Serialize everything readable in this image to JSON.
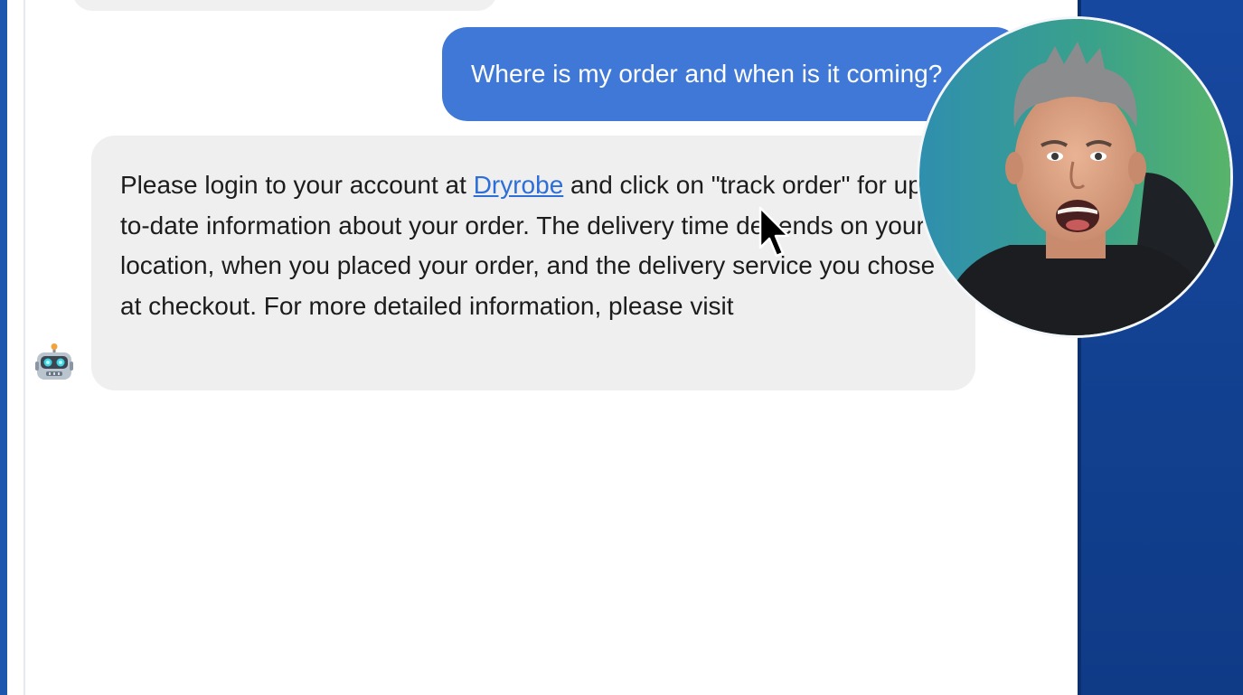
{
  "chat": {
    "user_message": "Where is my order and when is it coming?",
    "bot_message": {
      "before_link": "Please login to your account at ",
      "link_text": "Dryrobe",
      "after_link": " and click on \"track order\" for up-to-date information about your order. The delivery time depends on your location, when you placed your order, and the delivery service you chose at checkout. For more detailed information, please visit"
    }
  },
  "icons": {
    "bot_avatar": "robot-icon",
    "pointer": "mouse-cursor-icon"
  },
  "colors": {
    "user_bubble": "#3f78d6",
    "bot_bubble": "#efefef",
    "link": "#2d6fd6",
    "side_background": "#1a4fa0"
  }
}
